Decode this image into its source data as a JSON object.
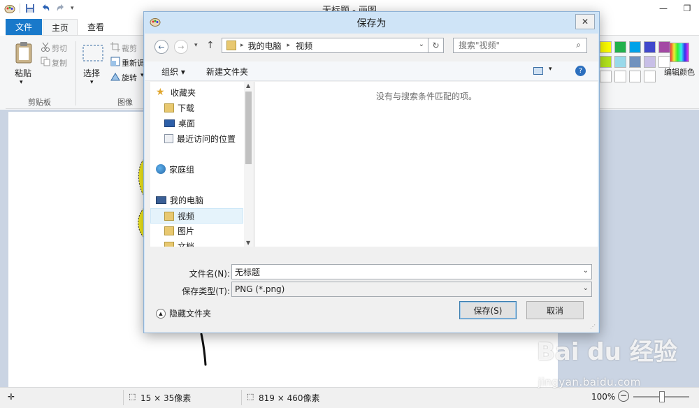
{
  "paint": {
    "title": "无标题 - 画图",
    "tabs": {
      "file": "文件",
      "home": "主页",
      "view": "查看"
    },
    "ribbon": {
      "paste": "粘贴",
      "cut": "剪切",
      "copy": "复制",
      "clipboard_group": "剪贴板",
      "select": "选择",
      "crop": "裁剪",
      "resize": "重新调",
      "rotate": "旋转",
      "image_group": "图像",
      "edit_colors": "编辑颜色"
    },
    "palette_colors": [
      "#ffff00",
      "#22b14c",
      "#00a2e8",
      "#3f48cc",
      "#a349a4",
      "#b5e61d",
      "#99d9ea",
      "#7092be",
      "#c8bfe7",
      "#ffffff",
      "#ffffff",
      "#ffffff",
      "#ffffff",
      "#ffffff"
    ],
    "status": {
      "selection_size": "15 × 35像素",
      "image_size": "819 × 460像素",
      "zoom": "100%"
    }
  },
  "dialog": {
    "title": "保存为",
    "breadcrumb": [
      "我的电脑",
      "视频"
    ],
    "search_placeholder": "搜索\"视频\"",
    "organize": "组织 ▾",
    "new_folder": "新建文件夹",
    "nav": {
      "favorites": "收藏夹",
      "downloads": "下载",
      "desktop": "桌面",
      "recent": "最近访问的位置",
      "homegroup": "家庭组",
      "computer": "我的电脑",
      "videos": "视频",
      "pictures": "图片",
      "documents": "文档"
    },
    "empty_message": "没有与搜索条件匹配的项。",
    "filename_label": "文件名(N):",
    "filename_value": "无标题",
    "filetype_label": "保存类型(T):",
    "filetype_value": "PNG (*.png)",
    "hide_folders": "隐藏文件夹",
    "save_button": "保存(S)",
    "cancel_button": "取消"
  },
  "watermark": {
    "brand": "Bai du 经验",
    "url": "jingyan.baidu.com"
  }
}
